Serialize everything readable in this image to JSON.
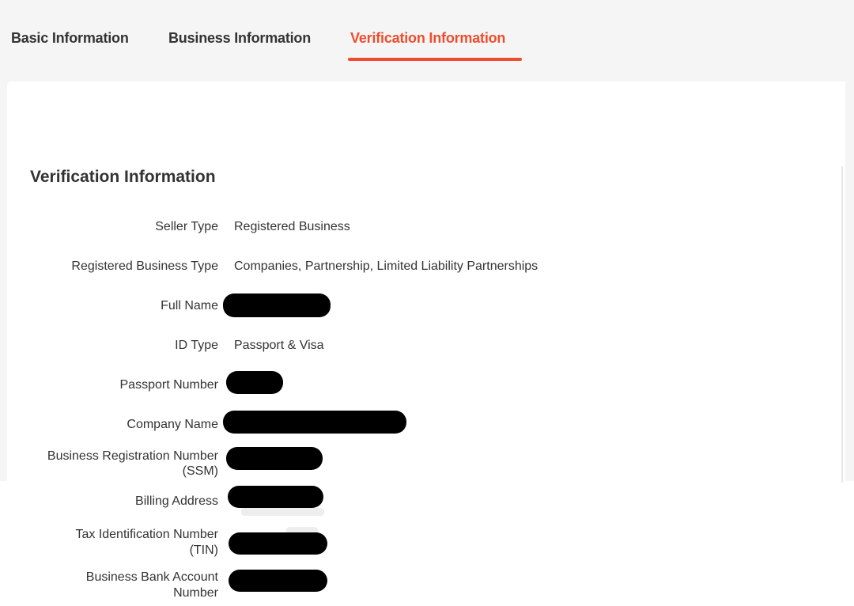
{
  "tabs": [
    {
      "label": "Basic Information",
      "active": false
    },
    {
      "label": "Business Information",
      "active": false
    },
    {
      "label": "Verification Information",
      "active": true
    }
  ],
  "accent_color": "#ee4d2d",
  "section": {
    "title": "Verification Information",
    "rows": [
      {
        "label": "Seller Type",
        "value": "Registered Business"
      },
      {
        "label": "Registered Business Type",
        "value": "Companies, Partnership, Limited Liability Partnerships"
      },
      {
        "label": "Full Name",
        "value": null,
        "redacted": true
      },
      {
        "label": "ID Type",
        "value": "Passport & Visa"
      },
      {
        "label": "Passport Number",
        "value": null,
        "redacted": true
      },
      {
        "label": "Company Name",
        "value": null,
        "redacted": true
      },
      {
        "label_line1": "Business Registration Number",
        "label_line2": "(SSM)",
        "value": null,
        "redacted": true
      },
      {
        "label": "Billing Address",
        "value": null,
        "redacted": true
      },
      {
        "label_line1": "Tax Identification Number",
        "label_line2": "(TIN)",
        "value": null,
        "redacted": true
      },
      {
        "label_line1": "Business Bank Account",
        "label_line2": "Number",
        "value": null,
        "redacted": true
      }
    ]
  }
}
